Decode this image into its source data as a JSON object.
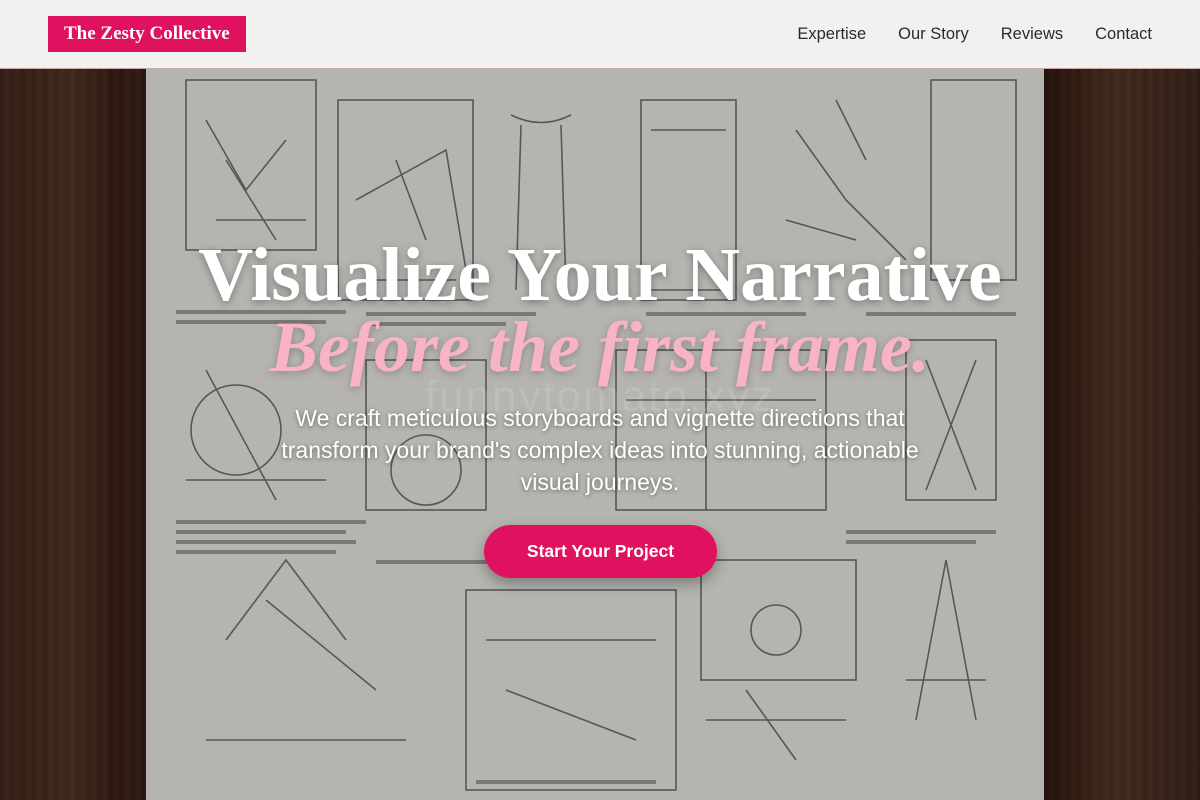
{
  "header": {
    "logo": "The Zesty Collective",
    "nav": [
      {
        "label": "Expertise"
      },
      {
        "label": "Our Story"
      },
      {
        "label": "Reviews"
      },
      {
        "label": "Contact"
      }
    ]
  },
  "hero": {
    "headline": "Visualize Your Narrative",
    "subheadline": "Before the first frame.",
    "watermark": "funnytomato.xyz",
    "description": "We craft meticulous storyboards and vignette directions that transform your brand's complex ideas into stunning, actionable visual journeys.",
    "cta_label": "Start Your Project",
    "background_image": "vintage engraving sheet of windmill and machinery illustrations on wooden table"
  },
  "colors": {
    "accent": "#e0125f",
    "subheadline": "#f8b3c7",
    "header_bg": "#f1f1f0"
  }
}
